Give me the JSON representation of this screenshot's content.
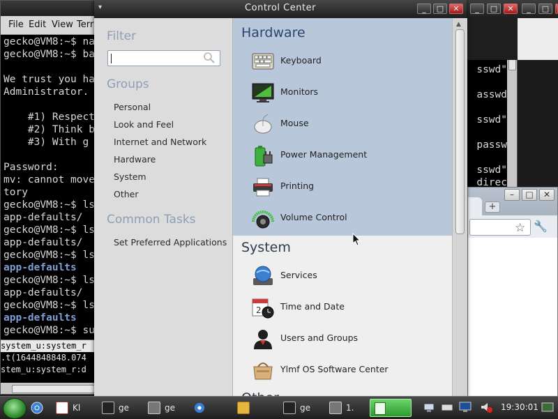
{
  "terminal": {
    "menu": [
      "File",
      "Edit",
      "View",
      "Terr"
    ],
    "lines": [
      "gecko@VM8:~$ na",
      "gecko@VM8:~$ ba",
      "",
      "We trust you ha",
      "Administrator.",
      "",
      "    #1) Respect",
      "    #2) Think b",
      "    #3) With g",
      "",
      "Password:",
      "mv: cannot move",
      "tory",
      "gecko@VM8:~$ ls",
      "app-defaults/",
      "gecko@VM8:~$ ls",
      "app-defaults/",
      "gecko@VM8:~$ ls",
      "app-defaults",
      "gecko@VM8:~$ ls",
      "app-defaults/",
      "gecko@VM8:~$ ls",
      "app-defaults",
      "gecko@VM8:~$ su"
    ],
    "bottom_lines": [
      "system_u:system_r",
      ".t(1644848848.074",
      "stem_u:system_r:d"
    ],
    "right_fragments": [
      "sswd\"",
      "asswd",
      "sswd\"",
      "passw",
      "sswd\"",
      "direc"
    ]
  },
  "control_center": {
    "title": "Control Center",
    "window_buttons": {
      "minimize": "_",
      "maximize": "□",
      "close": "✕"
    },
    "sidebar": {
      "filter_heading": "Filter",
      "filter_value": "",
      "groups_heading": "Groups",
      "groups": [
        "Personal",
        "Look and Feel",
        "Internet and Network",
        "Hardware",
        "System",
        "Other"
      ],
      "common_tasks_heading": "Common Tasks",
      "common_tasks": [
        "Set Preferred Applications"
      ]
    },
    "sections": [
      {
        "title": "Hardware",
        "selected": true,
        "items": [
          {
            "label": "Keyboard",
            "icon": "keyboard-icon"
          },
          {
            "label": "Monitors",
            "icon": "monitor-icon"
          },
          {
            "label": "Mouse",
            "icon": "mouse-icon"
          },
          {
            "label": "Power Management",
            "icon": "battery-icon"
          },
          {
            "label": "Printing",
            "icon": "printer-icon"
          },
          {
            "label": "Volume Control",
            "icon": "speaker-icon"
          }
        ]
      },
      {
        "title": "System",
        "selected": false,
        "items": [
          {
            "label": "Services",
            "icon": "services-icon"
          },
          {
            "label": "Time and Date",
            "icon": "calendar-clock-icon"
          },
          {
            "label": "Users and Groups",
            "icon": "users-icon"
          },
          {
            "label": "Ylmf OS Software Center",
            "icon": "software-center-icon"
          }
        ]
      },
      {
        "title": "Other",
        "selected": false,
        "items": []
      }
    ]
  },
  "browser": {
    "new_tab_label": "+"
  },
  "taskbar": {
    "tasks": [
      {
        "label": "Kl",
        "icon": "solitaire-icon"
      },
      {
        "label": "ge",
        "icon": "terminal-icon"
      },
      {
        "label": "ge",
        "icon": "terminal-icon"
      },
      {
        "label": "",
        "icon": "chrome-icon"
      },
      {
        "label": "ge",
        "icon": "terminal-icon"
      },
      {
        "label": "",
        "icon": "folder-icon"
      },
      {
        "label": "ge",
        "icon": "terminal-icon"
      },
      {
        "label": "1.",
        "icon": "terminal-icon"
      }
    ],
    "active_task_label": "",
    "clock": "19:30:01"
  }
}
